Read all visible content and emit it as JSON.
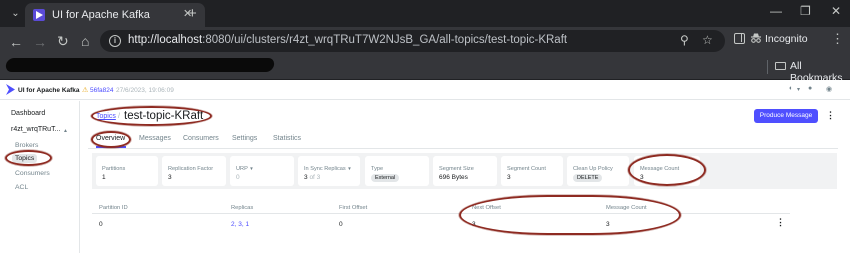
{
  "browser": {
    "tab_title": "UI for Apache Kafka",
    "url_host": "http://localhost",
    "url_path": ":8080/ui/clusters/r4zt_wrqTRuT7W2NJsB_GA/all-topics/test-topic-KRaft",
    "profile_label": "Incognito",
    "bookmarks_label": "All Bookmarks"
  },
  "app": {
    "name": "UI for Apache Kafka",
    "version": "56fa824",
    "build_date": "27/6/2023, 19:06:09"
  },
  "sidebar": {
    "dashboard": "Dashboard",
    "cluster": "r4zt_wrqTRuT...",
    "items": [
      "Brokers",
      "Topics",
      "Consumers",
      "ACL"
    ]
  },
  "breadcrumb": {
    "parent": "Topics",
    "separator": "/",
    "current": "test-topic-KRaft"
  },
  "produce_button": "Produce Message",
  "tabs": [
    "Overview",
    "Messages",
    "Consumers",
    "Settings",
    "Statistics"
  ],
  "stats": [
    {
      "label": "Partitions",
      "value": "1"
    },
    {
      "label": "Replication Factor",
      "value": "3"
    },
    {
      "label": "URP",
      "value": "0"
    },
    {
      "label": "In Sync Replicas",
      "value": "3",
      "suffix": "of 3"
    },
    {
      "label": "Type",
      "value": "External"
    },
    {
      "label": "Segment Size",
      "value": "696 Bytes"
    },
    {
      "label": "Segment Count",
      "value": "3"
    },
    {
      "label": "Clean Up Policy",
      "value": "DELETE"
    },
    {
      "label": "Message Count",
      "value": "3"
    }
  ],
  "table": {
    "headers": [
      "Partition ID",
      "Replicas",
      "First Offset",
      "Next Offset",
      "Message Count"
    ],
    "rows": [
      {
        "partition_id": "0",
        "replicas": "2, 3, 1",
        "first_offset": "0",
        "next_offset": "3",
        "message_count": "3"
      }
    ]
  },
  "colors": {
    "accent": "#4f4fff",
    "annotation": "#8e2b22",
    "link": "#4c4cff"
  }
}
